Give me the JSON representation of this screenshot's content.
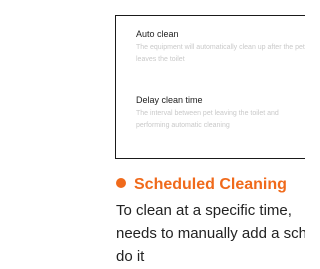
{
  "settings": {
    "auto_clean": {
      "title": "Auto clean",
      "description": "The equipment will automatically clean up after the pet leaves the toilet"
    },
    "delay_clean": {
      "title": "Delay clean time",
      "description": "The interval between pet leaving the toilet and performing automatic cleaning"
    }
  },
  "section": {
    "heading": "Scheduled Cleaning",
    "body_lines": [
      "To clean at a specific time,",
      "needs to manually add a schedule to",
      "do it"
    ]
  },
  "colors": {
    "accent": "#f06a1b",
    "muted_text": "#c9c9c9",
    "text": "#222222"
  }
}
